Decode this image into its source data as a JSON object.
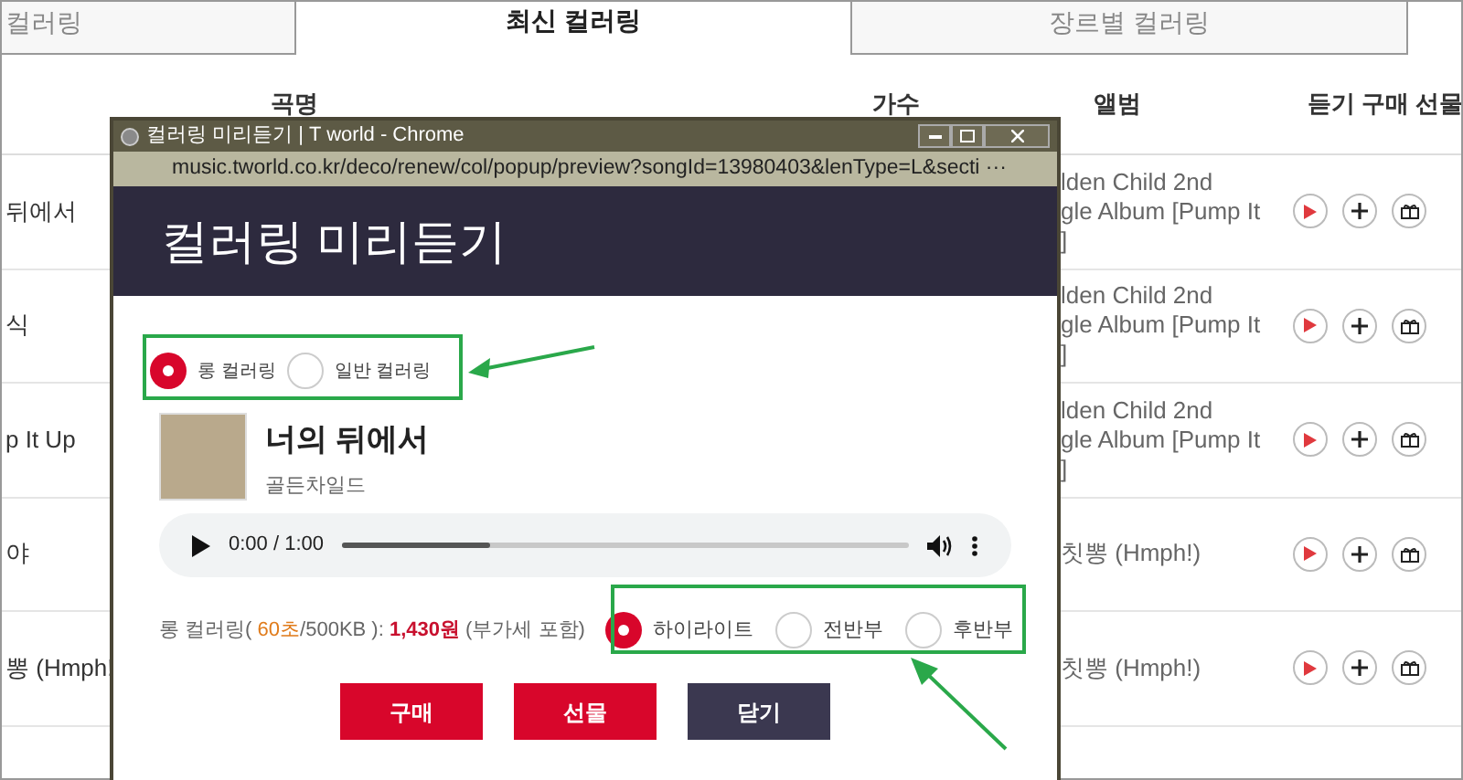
{
  "tabs": [
    {
      "label": "컬러링",
      "selected": false
    },
    {
      "label": "최신 컬러링",
      "selected": true
    },
    {
      "label": "장르별 컬러링",
      "selected": false
    }
  ],
  "table": {
    "columns": [
      "곡명",
      "가수",
      "앨범",
      "듣기 구매 선물"
    ],
    "rows": [
      {
        "title": "뒤에서",
        "album": [
          "lden Child 2nd",
          "gle Album [Pump It",
          "]"
        ]
      },
      {
        "title": "식",
        "album": [
          "lden Child 2nd",
          "gle Album [Pump It",
          "]"
        ]
      },
      {
        "title": "p It Up",
        "album": [
          "lden Child 2nd",
          "gle Album [Pump It",
          "]"
        ]
      },
      {
        "title": "야",
        "album": [
          "칫뽕 (Hmph!)"
        ]
      },
      {
        "title": "뽕 (Hmph!",
        "album": [
          "칫뽕 (Hmph!)"
        ]
      }
    ]
  },
  "popup": {
    "window_title": "컬러링 미리듣기 | T world - Chrome",
    "url": "music.tworld.co.kr/deco/renew/col/popup/preview?songId=13980403&lenType=L&secti ···",
    "heading": "컬러링 미리듣기",
    "types": [
      {
        "label": "롱 컬러링",
        "selected": true
      },
      {
        "label": "일반 컬러링",
        "selected": false
      }
    ],
    "song": {
      "title": "너의 뒤에서",
      "artist": "골든차일드"
    },
    "player": {
      "time": "0:00 / 1:00",
      "level": 0.26
    },
    "price": {
      "prefix": "롱 컬러링( ",
      "duration": "60초",
      "size": "/500KB ): ",
      "amount": "1,430원",
      "note": " (부가세 포함)"
    },
    "sections": [
      {
        "label": "하이라이트",
        "selected": true
      },
      {
        "label": "전반부",
        "selected": false
      },
      {
        "label": "후반부",
        "selected": false
      }
    ],
    "buttons": [
      {
        "label": "구매",
        "kind": "primary"
      },
      {
        "label": "선물",
        "kind": "primary"
      },
      {
        "label": "닫기",
        "kind": "dark"
      }
    ]
  }
}
